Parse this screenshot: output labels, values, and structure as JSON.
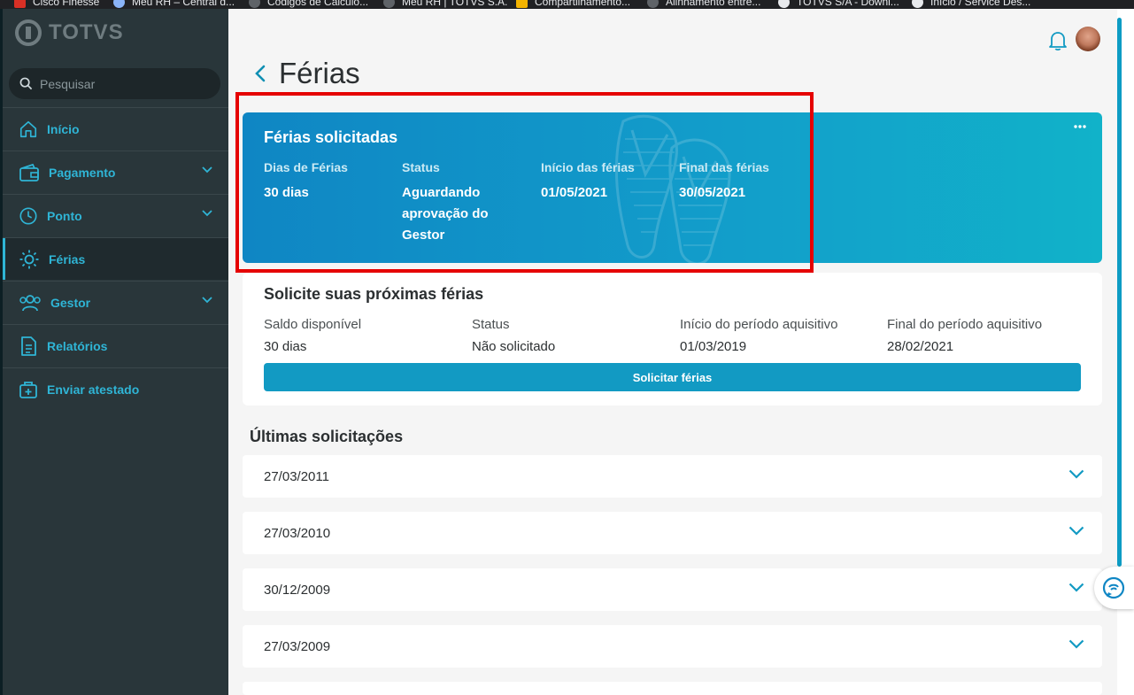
{
  "bookmarks": [
    {
      "label": "Cisco Finesse"
    },
    {
      "label": "Meu RH – Central d..."
    },
    {
      "label": "Códigos de Cálculo..."
    },
    {
      "label": "Meu RH | TOTVS S.A."
    },
    {
      "label": "Compartilhamento..."
    },
    {
      "label": "Alinhamento entre..."
    },
    {
      "label": "TOTVS S/A - Downl..."
    },
    {
      "label": "Início / Service Des..."
    }
  ],
  "brand": {
    "name": "TOTVS"
  },
  "search": {
    "placeholder": "Pesquisar"
  },
  "sidebar": {
    "items": [
      {
        "label": "Início",
        "icon": "home-icon",
        "has_chevron": false,
        "active": false
      },
      {
        "label": "Pagamento",
        "icon": "wallet-icon",
        "has_chevron": true,
        "active": false
      },
      {
        "label": "Ponto",
        "icon": "clock-icon",
        "has_chevron": true,
        "active": false
      },
      {
        "label": "Férias",
        "icon": "sun-icon",
        "has_chevron": false,
        "active": true
      },
      {
        "label": "Gestor",
        "icon": "people-icon",
        "has_chevron": true,
        "active": false
      },
      {
        "label": "Relatórios",
        "icon": "document-icon",
        "has_chevron": false,
        "active": false
      },
      {
        "label": "Enviar atestado",
        "icon": "medical-bag-icon",
        "has_chevron": false,
        "active": false
      }
    ]
  },
  "header": {
    "title": "Férias"
  },
  "requested": {
    "title": "Férias solicitadas",
    "fields": [
      {
        "label": "Dias de Férias",
        "value": "30 dias"
      },
      {
        "label": "Status",
        "value": "Aguardando aprovação do Gestor"
      },
      {
        "label": "Início das férias",
        "value": "01/05/2021"
      },
      {
        "label": "Final das férias",
        "value": "30/05/2021"
      }
    ]
  },
  "next": {
    "title": "Solicite suas próximas férias",
    "fields": [
      {
        "label": "Saldo disponível",
        "value": "30 dias"
      },
      {
        "label": "Status",
        "value": "Não solicitado"
      },
      {
        "label": "Início do período aquisitivo",
        "value": "01/03/2019"
      },
      {
        "label": "Final do período aquisitivo",
        "value": "28/02/2021"
      }
    ],
    "button_label": "Solicitar férias"
  },
  "history": {
    "title": "Últimas solicitações",
    "rows": [
      {
        "date": "27/03/2011"
      },
      {
        "date": "27/03/2010"
      },
      {
        "date": "30/12/2009"
      },
      {
        "date": "27/03/2009"
      }
    ]
  },
  "colors": {
    "accent": "#129ac3",
    "sidebar_bg": "#29363a",
    "highlight": "#e50000"
  }
}
